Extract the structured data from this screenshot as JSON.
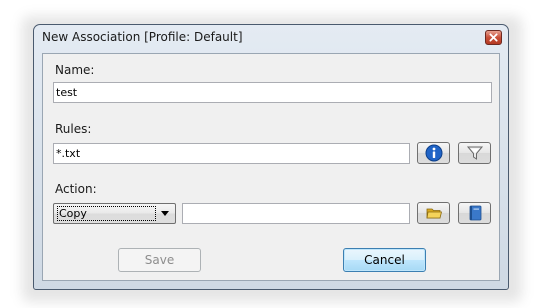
{
  "window": {
    "title": "New Association [Profile: Default]"
  },
  "form": {
    "name": {
      "label": "Name:",
      "value": "test"
    },
    "rules": {
      "label": "Rules:",
      "value": "*.txt"
    },
    "action": {
      "label": "Action:",
      "selected": "Copy",
      "value": ""
    }
  },
  "buttons": {
    "save_label": "Save",
    "cancel_label": "Cancel"
  },
  "icons": {
    "info": "info-icon",
    "filter": "filter-icon",
    "folder": "folder-icon",
    "book": "book-icon",
    "close": "close-icon"
  },
  "colors": {
    "accent": "#3c7fb1",
    "close": "#c9503a"
  }
}
